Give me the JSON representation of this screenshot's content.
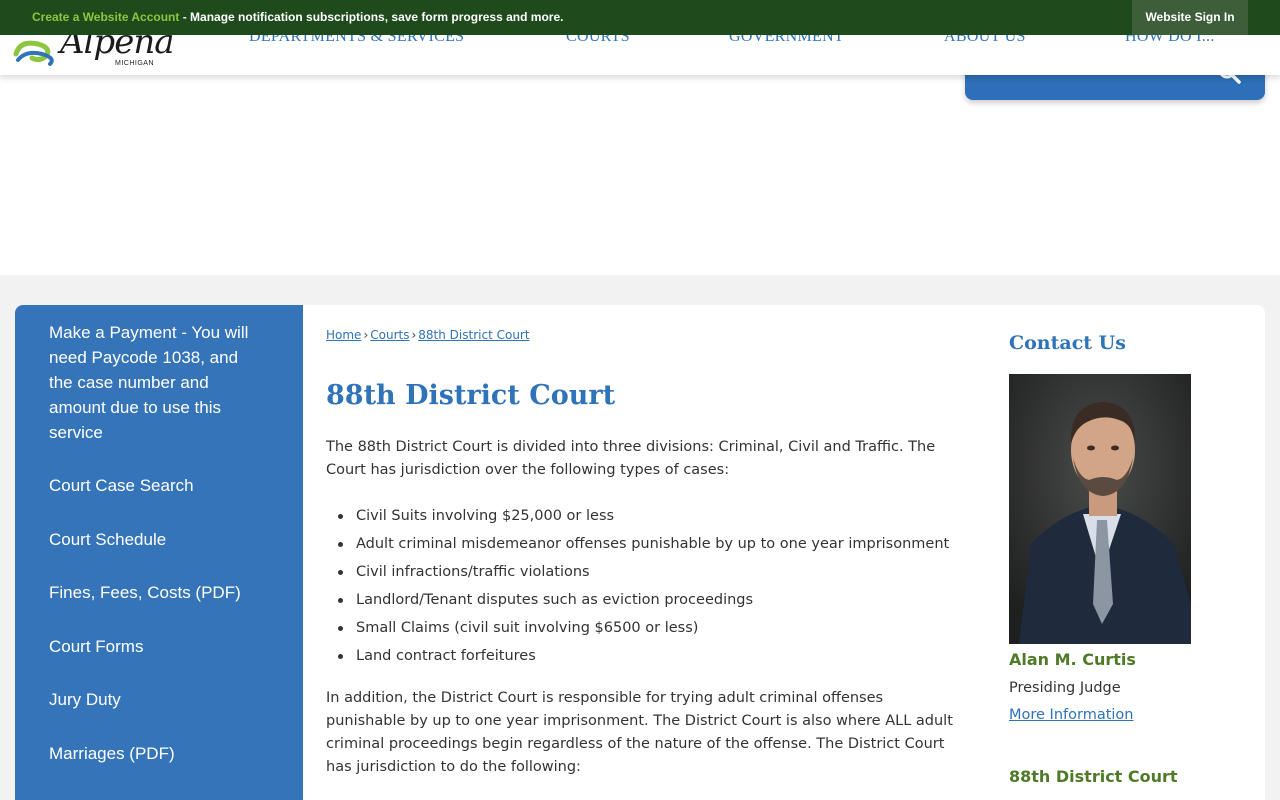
{
  "notification_bar": {
    "link_text": "Create a Website Account",
    "message": " - Manage notification subscriptions, save form progress and more.",
    "signin_label": "Website Sign In"
  },
  "header": {
    "logo_text": "Alpena",
    "logo_subtext": "MICHIGAN",
    "nav": [
      "DEPARTMENTS & SERVICES",
      "COURTS",
      "GOVERNMENT",
      "ABOUT US",
      "HOW DO I..."
    ]
  },
  "sidebar": {
    "items": [
      "Make a Payment - You will need Paycode 1038, and the case number and amount due to use this service",
      "Court Case Search",
      "Court Schedule",
      "Fines, Fees, Costs (PDF)",
      "Court Forms",
      "Jury Duty",
      "Marriages (PDF)"
    ]
  },
  "breadcrumb": {
    "items": [
      "Home",
      "Courts",
      "88th District Court"
    ],
    "separator": "›"
  },
  "main": {
    "title": "88th District Court",
    "intro": "The 88th District Court is divided into three divisions: Criminal, Civil and Traffic. The Court has jurisdiction over the following types of cases:",
    "case_types": [
      "Civil Suits involving $25,000 or less",
      "Adult criminal misdemeanor offenses punishable by up to one year imprisonment",
      "Civil infractions/traffic violations",
      "Landlord/Tenant disputes such as eviction proceedings",
      "Small Claims (civil suit involving $6500 or less)",
      "Land contract forfeitures"
    ],
    "addition": "In addition, the District Court is responsible for trying adult criminal offenses punishable by up to one year imprisonment. The District Court is also where ALL adult criminal proceedings begin regardless of the nature of the offense. The District Court has jurisdiction to do the following:"
  },
  "contact": {
    "heading": "Contact Us",
    "name": "Alan M. Curtis",
    "role": "Presiding Judge",
    "more_link": "More Information",
    "court_heading": "88th District Court"
  },
  "colors": {
    "notify_bg": "#1f4a1c",
    "accent_blue": "#2f73b8",
    "sidebar_blue": "#3574b8",
    "accent_green": "#4f7a28"
  }
}
